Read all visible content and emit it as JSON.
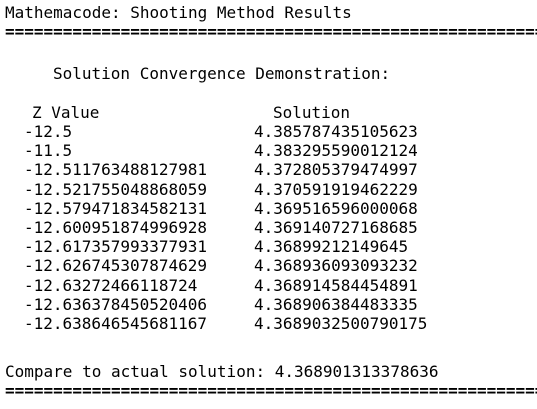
{
  "title": "Mathemacode: Shooting Method Results",
  "separator": "=========================================================",
  "section_heading": "Solution Convergence Demonstration:",
  "columns": {
    "z": "Z Value",
    "solution": "Solution"
  },
  "rows": [
    {
      "z": "-12.5",
      "solution": "4.385787435105623"
    },
    {
      "z": "-11.5",
      "solution": "4.383295590012124"
    },
    {
      "z": "-12.511763488127981",
      "solution": "4.372805379474997"
    },
    {
      "z": "-12.521755048868059",
      "solution": "4.370591919462229"
    },
    {
      "z": "-12.579471834582131",
      "solution": "4.369516596000068"
    },
    {
      "z": "-12.600951874996928",
      "solution": "4.369140727168685"
    },
    {
      "z": "-12.617357993377931",
      "solution": "4.36899212149645"
    },
    {
      "z": "-12.626745307874629",
      "solution": "4.368936093093232"
    },
    {
      "z": "-12.63272466118724",
      "solution": "4.368914584454891"
    },
    {
      "z": "-12.636378450520406",
      "solution": "4.368906384483335"
    },
    {
      "z": "-12.638646545681167",
      "solution": "4.3689032500790175"
    }
  ],
  "comparison": "Compare to actual solution: 4.368901313378636"
}
